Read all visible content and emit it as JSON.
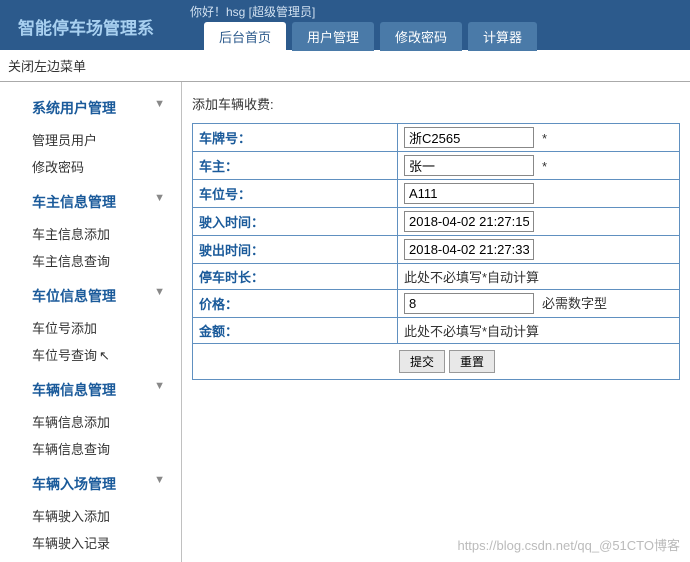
{
  "header": {
    "title": "智能停车场管理系",
    "welcome": "你好！hsg [超级管理员]",
    "tabs": [
      {
        "label": "后台首页",
        "active": true
      },
      {
        "label": "用户管理",
        "active": false
      },
      {
        "label": "修改密码",
        "active": false
      },
      {
        "label": "计算器",
        "active": false
      }
    ]
  },
  "close_menu_label": "关闭左边菜单",
  "sidebar": {
    "groups": [
      {
        "title": "系统用户管理",
        "items": [
          "管理员用户",
          "修改密码"
        ]
      },
      {
        "title": "车主信息管理",
        "items": [
          "车主信息添加",
          "车主信息查询"
        ]
      },
      {
        "title": "车位信息管理",
        "items": [
          "车位号添加",
          "车位号查询"
        ]
      },
      {
        "title": "车辆信息管理",
        "items": [
          "车辆信息添加",
          "车辆信息查询"
        ]
      },
      {
        "title": "车辆入场管理",
        "items": [
          "车辆驶入添加",
          "车辆驶入记录"
        ]
      }
    ]
  },
  "form": {
    "title": "添加车辆收费:",
    "rows": [
      {
        "label": "车牌号：",
        "value": "浙C2565",
        "hint": "*"
      },
      {
        "label": "车主：",
        "value": "张一",
        "hint": "*"
      },
      {
        "label": "车位号：",
        "value": "A111",
        "hint": ""
      },
      {
        "label": "驶入时间：",
        "value": "2018-04-02 21:27:15",
        "hint": ""
      },
      {
        "label": "驶出时间：",
        "value": "2018-04-02 21:27:33",
        "hint": ""
      },
      {
        "label": "停车时长：",
        "value": "",
        "hint": "此处不必填写*自动计算",
        "noinput": true
      },
      {
        "label": "价格：",
        "value": "8",
        "hint": "必需数字型"
      },
      {
        "label": "金额：",
        "value": "",
        "hint": "此处不必填写*自动计算",
        "noinput": true
      }
    ],
    "submit_label": "提交",
    "reset_label": "重置"
  },
  "watermark": "https://blog.csdn.net/qq_@51CTO博客"
}
